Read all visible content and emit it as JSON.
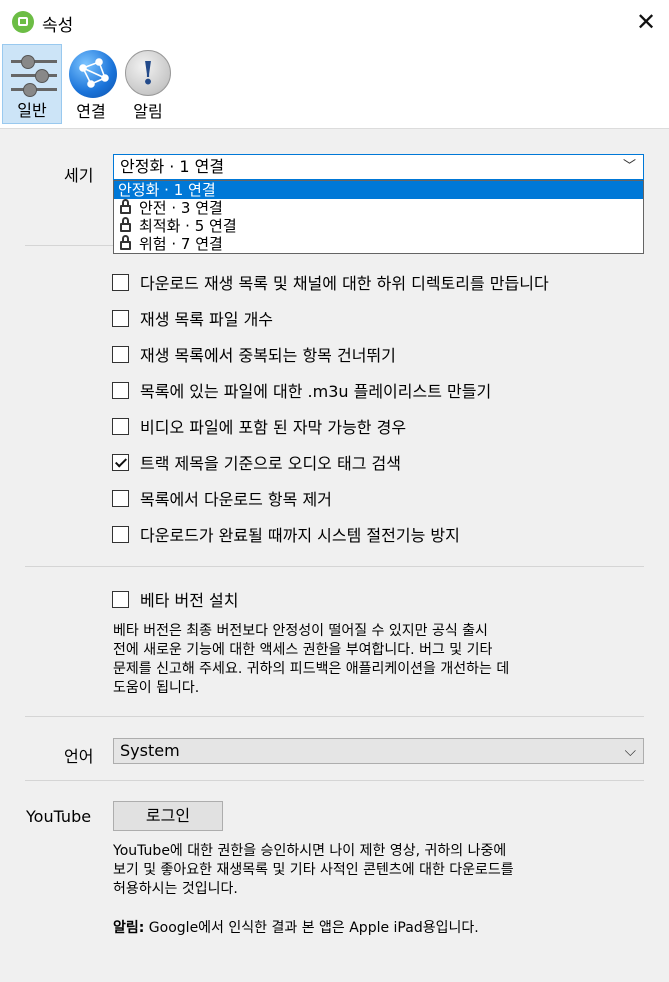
{
  "window": {
    "title": "속성"
  },
  "toolbar": {
    "tabs": [
      {
        "label": "일반",
        "icon": "sliders-icon",
        "active": true
      },
      {
        "label": "연결",
        "icon": "globe-network-icon",
        "active": false
      },
      {
        "label": "알림",
        "icon": "exclamation-icon",
        "active": false
      }
    ]
  },
  "size": {
    "label": "세기",
    "selected": "안정화 · 1 연결",
    "options": [
      {
        "label": "안정화 · 1 연결",
        "locked": false,
        "selected": true
      },
      {
        "label": "안전 · 3 연결",
        "locked": true
      },
      {
        "label": "최적화 · 5 연결",
        "locked": true
      },
      {
        "label": "위험 · 7 연결",
        "locked": true
      }
    ]
  },
  "options": [
    {
      "label": "다운로드 재생 목록 및 채널에 대한 하위 디렉토리를 만듭니다",
      "checked": false
    },
    {
      "label": "재생 목록 파일 개수",
      "checked": false
    },
    {
      "label": "재생 목록에서 중복되는 항목 건너뛰기",
      "checked": false
    },
    {
      "label": "목록에 있는 파일에 대한 .m3u 플레이리스트 만들기",
      "checked": false
    },
    {
      "label": "비디오 파일에 포함 된 자막 가능한 경우",
      "checked": false
    },
    {
      "label": "트랙 제목을 기준으로 오디오 태그 검색",
      "checked": true
    },
    {
      "label": "목록에서 다운로드 항목 제거",
      "checked": false
    },
    {
      "label": "다운로드가 완료될 때까지 시스템 절전기능 방지",
      "checked": false
    }
  ],
  "beta": {
    "label": "베타 버전 설치",
    "checked": false,
    "lines": [
      "베타 버전은 최종 버전보다 안정성이 떨어질 수 있지만 공식 출시",
      "전에 새로운 기능에 대한 액세스 권한을 부여합니다. 버그 및 기타",
      "문제를 신고해 주세요. 귀하의 피드백은 애플리케이션을 개선하는 데",
      "도움이 됩니다."
    ]
  },
  "language": {
    "label": "언어",
    "selected": "System"
  },
  "youtube": {
    "label": "YouTube",
    "login_button": "로그인",
    "lines": [
      "YouTube에 대한 권한을 승인하시면 나이 제한 영상, 귀하의 나중에",
      "보기 및 좋아요한 재생목록 및 기타 사적인 콘텐츠에 대한 다운로드를",
      "허용하시는 것입니다."
    ],
    "note_label": "알림:",
    "note_text": " Google에서 인식한 결과 본 앱은 Apple iPad용입니다."
  },
  "colors": {
    "accent": "#0078d7",
    "active_tab": "#cce4f7"
  }
}
